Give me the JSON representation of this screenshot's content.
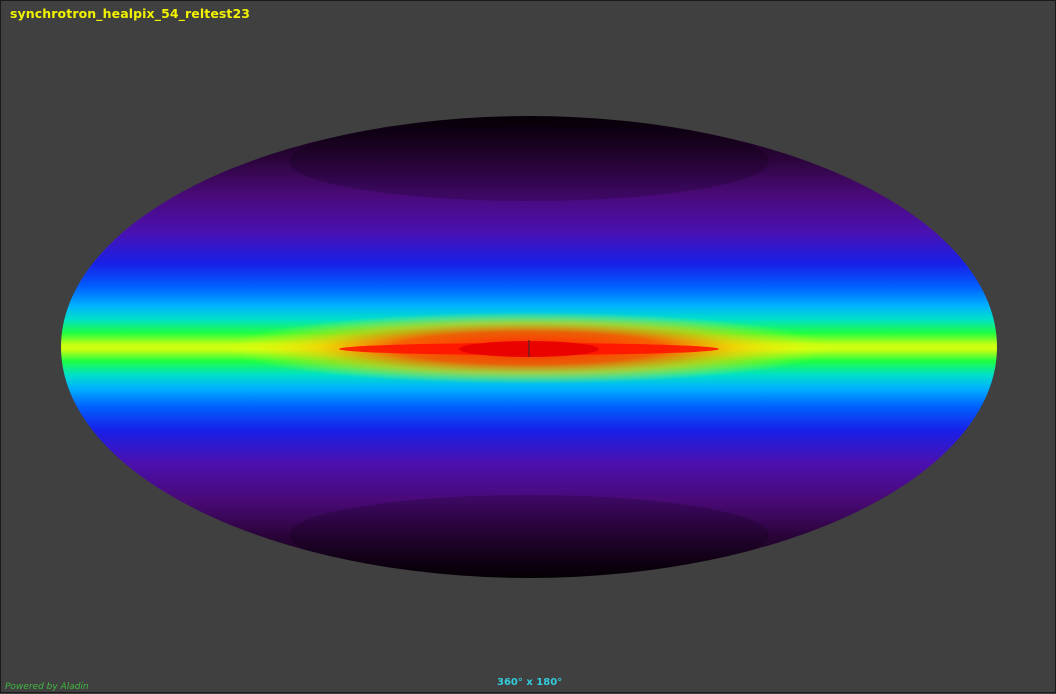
{
  "survey": {
    "title": "synchrotron_healpix_54_reltest23"
  },
  "view": {
    "projection": "Aitoff / Mollweide all-sky",
    "field_of_view": "360° x 180°"
  },
  "footer": {
    "powered_by": "Powered by Aladin"
  },
  "colors": {
    "background": "#404040",
    "title": "#f2f200",
    "fov": "#33ccdd",
    "powered_by": "#3fb83f"
  }
}
